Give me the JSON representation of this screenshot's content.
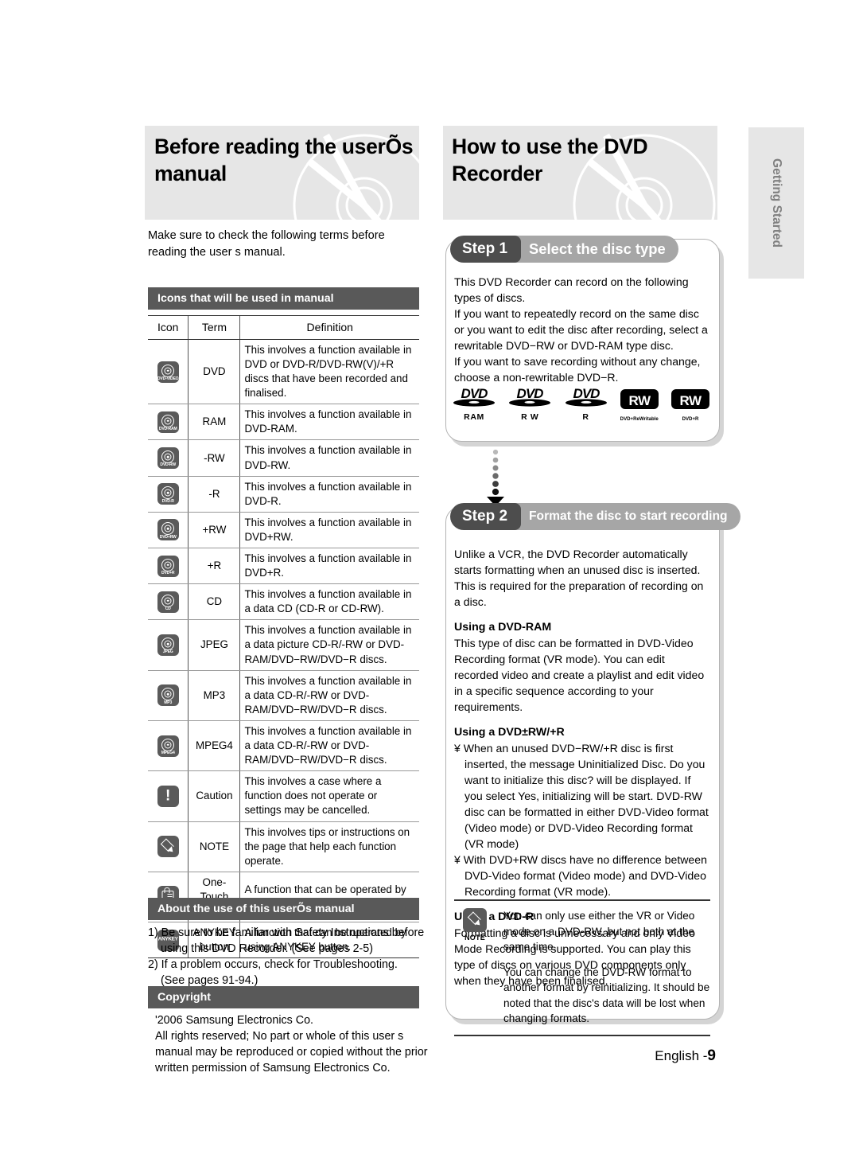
{
  "page": {
    "footer_label": "English -",
    "footer_number": "9",
    "side_tab": "Getting Started"
  },
  "left": {
    "header_title": "Before reading the userÕs manual",
    "lead": "Make sure to check the following terms before reading the user s manual.",
    "section_icons_title": "Icons that will be used in manual",
    "table": {
      "headers": [
        "Icon",
        "Term",
        "Definition"
      ],
      "rows": [
        {
          "icon": "dvd-video-icon",
          "icon_label": "DVD-VIDEO",
          "term": "DVD",
          "definition": "This involves a function available in DVD or DVD-R/DVD-RW(V)/+R discs that have been recorded and finalised."
        },
        {
          "icon": "dvd-ram-icon",
          "icon_label": "DVD-RAM",
          "term": "RAM",
          "definition": "This involves a function available in DVD-RAM."
        },
        {
          "icon": "dvd-rw-icon",
          "icon_label": "DVD-RW",
          "term": "-RW",
          "definition": "This involves a function available in DVD-RW."
        },
        {
          "icon": "dvd-r-icon",
          "icon_label": "DVD-R",
          "term": "-R",
          "definition": "This involves a function available in DVD-R."
        },
        {
          "icon": "dvd-plus-rw-icon",
          "icon_label": "DVD+RW",
          "term": "+RW",
          "definition": "This involves a function available in DVD+RW."
        },
        {
          "icon": "dvd-plus-r-icon",
          "icon_label": "DVD+R",
          "term": "+R",
          "definition": "This involves a function available in DVD+R."
        },
        {
          "icon": "cd-icon",
          "icon_label": "CD",
          "term": "CD",
          "definition": "This involves a function available in a data CD (CD-R or CD-RW)."
        },
        {
          "icon": "jpeg-icon",
          "icon_label": "JPEG",
          "term": "JPEG",
          "definition": "This involves a function available in a data picture CD-R/-RW or DVD-RAM/DVD−RW/DVD−R discs."
        },
        {
          "icon": "mp3-icon",
          "icon_label": "MP3",
          "term": "MP3",
          "definition": "This involves a function available in a data CD-R/-RW or DVD-RAM/DVD−RW/DVD−R discs."
        },
        {
          "icon": "mpeg4-icon",
          "icon_label": "MPEG4",
          "term": "MPEG4",
          "definition": "This involves a function available in a data CD-R/-RW or DVD-RAM/DVD−RW/DVD−R discs."
        },
        {
          "icon": "caution-icon",
          "icon_label": "!",
          "term": "Caution",
          "definition": "This involves a case where a function does not operate or settings may be cancelled."
        },
        {
          "icon": "note-pencil-icon",
          "icon_label": "NOTE",
          "term": "NOTE",
          "definition": "This involves tips or instructions on the page that help each function operate."
        },
        {
          "icon": "one-touch-hand-icon",
          "icon_label": "",
          "term": "One-Touch button",
          "definition": "A function that can be operated by using only one button."
        },
        {
          "icon": "anykey-icon",
          "icon_label": "ANYKEY",
          "term": "ANYKEY button",
          "definition": "A function that can be operated by using ANYKEY button."
        }
      ]
    },
    "section_about_title": "About the use of this userÕs manual",
    "about_items": [
      "1) Be sure to be familiar with Safety Instructions before using this DVD Recorder. (See pages 2-5)",
      "2) If a problem occurs, check for Troubleshooting. (See pages 91-94.)"
    ],
    "section_copyright_title": "Copyright",
    "copyright_lines": [
      "'2006 Samsung Electronics Co.",
      "All rights reserved; No part or whole of this user s manual may be reproduced or copied without the prior written permission of Samsung Electronics Co."
    ]
  },
  "right": {
    "header_title": "How to use the DVD Recorder",
    "step1": {
      "number": "Step 1",
      "name": "Select the disc type",
      "paragraphs": [
        "This DVD Recorder can record on the following types of discs.",
        "If you want to repeatedly record on the same disc or you want to edit the disc after recording, select a rewritable DVD−RW or DVD-RAM type disc.",
        "If you want to save recording without any change, choose a non-rewritable DVD−R."
      ],
      "logos": [
        {
          "mark": "DVD",
          "caption": "RAM",
          "style": "dvd"
        },
        {
          "mark": "DVD",
          "caption": "R W",
          "style": "dvd"
        },
        {
          "mark": "DVD",
          "caption": "R",
          "style": "dvd"
        },
        {
          "mark": "RW",
          "caption": "DVD+ReWritable",
          "style": "rw"
        },
        {
          "mark": "RW",
          "caption": "DVD+R",
          "style": "rw"
        }
      ]
    },
    "step2": {
      "number": "Step 2",
      "name": "Format the disc to start recording",
      "intro": "Unlike a VCR, the DVD Recorder automatically starts formatting when an unused disc is inserted. This is required for the preparation of recording on a disc.",
      "sub1_title": "Using a DVD-RAM",
      "sub1_body": "This type of disc can be formatted in DVD-Video Recording format (VR mode). You can edit recorded video and create a playlist and edit video in a specific sequence according to your requirements.",
      "sub2_title": "Using a DVD±RW/+R",
      "sub2_bullets": [
        "¥ When an unused DVD−RW/+R disc is first inserted, the message  Uninitialized Disc. Do you want to initialize this disc?  will be displayed. If you select Yes, initializing will be start. DVD-RW disc can be formatted in either DVD-Video format (Video mode) or DVD-Video Recording format (VR mode)",
        "¥ With DVD+RW discs have no difference between DVD-Video format (Video mode) and DVD-Video Recording format (VR mode)."
      ],
      "sub3_title": "Using a DVD-R",
      "sub3_body": "Formatting a disc is unnecessary and only Video Mode Recording is supported. You can play this type of discs on various DVD components only when they have been finalised."
    },
    "note": {
      "label": "NOTE",
      "paragraphs": [
        "You can only use either the VR or Video mode on a DVD-RW, but not both at the same time.",
        "You can change the DVD-RW format to another format by reinitializing. It should be noted that the disc's data will be lost when changing formats."
      ]
    }
  },
  "colors": {
    "band": "#e6e6e6",
    "section_bar": "#595959",
    "step_num": "#4d4d4d",
    "step_name": "#a6a6a6",
    "icon_bg": "#5a5a5a"
  }
}
